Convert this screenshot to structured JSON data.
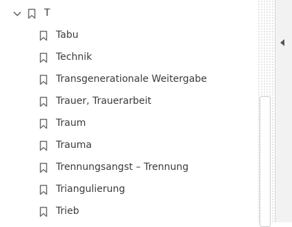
{
  "group": {
    "label": "T",
    "expanded": true
  },
  "bookmarks": [
    "Tabu",
    "Technik",
    "Transgenerationale Weitergabe",
    "Trauer, Trauerarbeit",
    "Traum",
    "Trauma",
    "Trennungsangst – Trennung",
    "Triangulierung",
    "Trieb"
  ],
  "colors": {
    "icon": "#6b6b6b",
    "text": "#3a3a3a",
    "side_panel": "#f2f2f2"
  },
  "icons": {
    "expand": "chevron-down-icon",
    "bookmark": "bookmark-icon",
    "collapse_panel": "caret-left-icon"
  }
}
